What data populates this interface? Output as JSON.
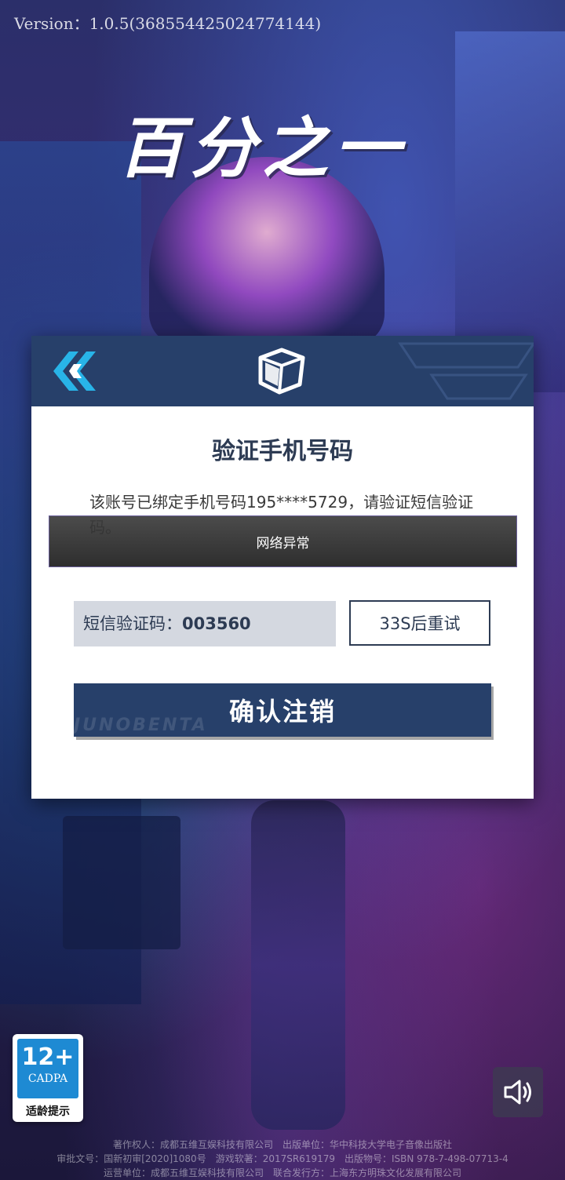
{
  "version_text": "Version：1.0.5(3685544250247741​44)",
  "logo_text": "百分之一",
  "dialog": {
    "title": "验证手机号码",
    "description": "该账号已绑定手机号码195****5729，请验证短信验证码。",
    "toast": "网络异常",
    "code_label": "短信验证码：",
    "code_value": "003560",
    "retry_label": "33S后重试",
    "confirm_label": "确认注销",
    "confirm_watermark": "JUNOBENTA"
  },
  "age_badge": {
    "age": "12+",
    "org": "CADPA",
    "caption": "适龄提示"
  },
  "footer": {
    "line1": "著作权人：成都五维互娱科技有限公司　出版单位：华中科技大学电子音像出版社",
    "line2": "审批文号：国新初审[2020]1080号　游戏软著：2017SR619179　出版物号：ISBN 978-7-498-07713-4",
    "line3": "运营单位：成都五维互娱科技有限公司　联合发行方：上海东方明珠文化发展有限公司"
  },
  "colors": {
    "header": "#27406a",
    "accent": "#28b4e8",
    "text_dark": "#2d3b53"
  },
  "icons": [
    "back-chevron-icon",
    "cube-icon",
    "speaker-icon"
  ]
}
